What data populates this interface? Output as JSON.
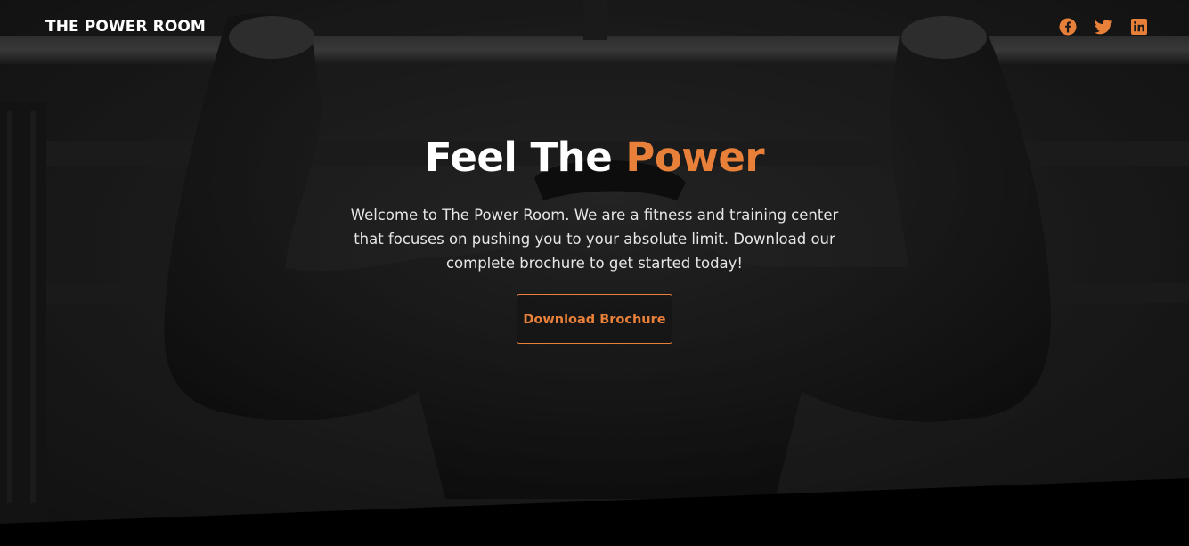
{
  "header": {
    "brand": "THE POWER ROOM",
    "socials": [
      {
        "name": "facebook",
        "icon": "facebook-icon"
      },
      {
        "name": "twitter",
        "icon": "twitter-icon"
      },
      {
        "name": "linkedin",
        "icon": "linkedin-icon"
      }
    ]
  },
  "hero": {
    "title_main": "Feel The ",
    "title_accent": "Power",
    "description": "Welcome to The Power Room. We are a fitness and training center that focuses on pushing you to your absolute limit. Download our complete brochure to get started today!",
    "cta_label": "Download Brochure"
  },
  "colors": {
    "accent": "#e8803a",
    "background": "#000000",
    "text": "#ffffff"
  }
}
